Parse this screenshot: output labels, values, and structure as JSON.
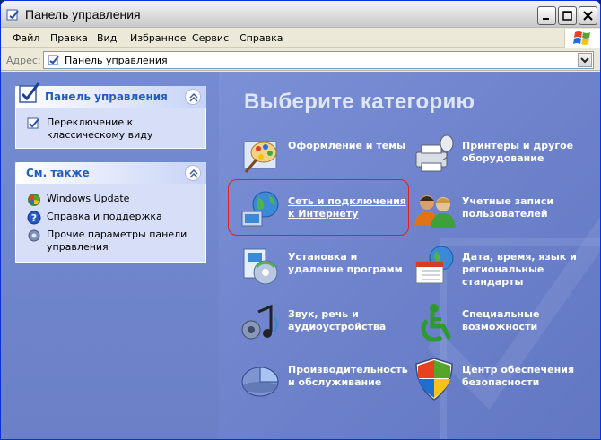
{
  "window": {
    "title": "Панель управления"
  },
  "menu": {
    "items": [
      {
        "label": "Файл"
      },
      {
        "label": "Правка"
      },
      {
        "label": "Вид"
      },
      {
        "label": "Избранное"
      },
      {
        "label": "Сервис"
      },
      {
        "label": "Справка"
      }
    ]
  },
  "address": {
    "label": "Адрес:",
    "value": "Панель управления"
  },
  "sidebar": {
    "control_panel": {
      "title": "Панель управления",
      "links": [
        {
          "label": "Переключение к классическому виду",
          "icon": "switch-view-icon"
        }
      ]
    },
    "see_also": {
      "title": "См. также",
      "links": [
        {
          "label": "Windows Update",
          "icon": "windows-update-icon"
        },
        {
          "label": "Справка и поддержка",
          "icon": "help-icon"
        },
        {
          "label": "Прочие параметры панели управления",
          "icon": "gear-icon"
        }
      ]
    }
  },
  "main": {
    "title": "Выберите категорию",
    "categories": [
      {
        "label": "Оформление и темы",
        "icon": "appearance-icon"
      },
      {
        "label": "Принтеры и другое оборудование",
        "icon": "printer-icon"
      },
      {
        "label": "Сеть и подключения к Интернету",
        "icon": "network-icon",
        "highlighted": true
      },
      {
        "label": "Учетные записи пользователей",
        "icon": "users-icon"
      },
      {
        "label": "Установка и удаление программ",
        "icon": "add-remove-icon"
      },
      {
        "label": "Дата, время, язык и региональные стандарты",
        "icon": "date-time-icon"
      },
      {
        "label": "Звук, речь и аудиоустройства",
        "icon": "sound-icon"
      },
      {
        "label": "Специальные возможности",
        "icon": "accessibility-icon"
      },
      {
        "label": "Производительность и обслуживание",
        "icon": "performance-icon"
      },
      {
        "label": "Центр обеспечения безопасности",
        "icon": "security-shield-icon"
      }
    ]
  },
  "colors": {
    "accent_link": "#215dc6",
    "highlight_frame": "#e02020",
    "pane_blue": "#6d82cb"
  }
}
